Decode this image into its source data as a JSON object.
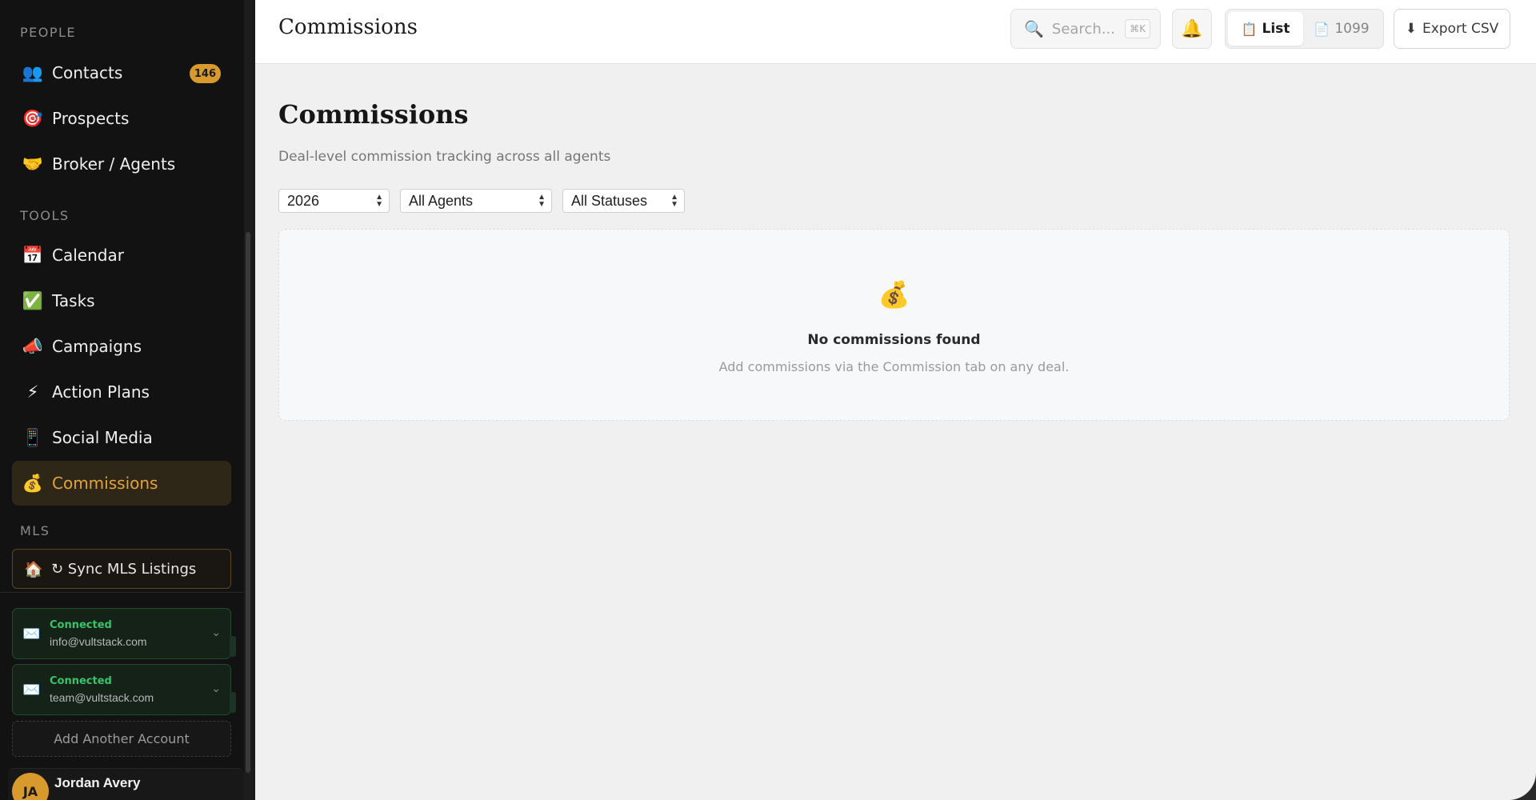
{
  "sidebar": {
    "sections": {
      "people": "PEOPLE",
      "tools": "TOOLS",
      "mls": "MLS"
    },
    "items": [
      {
        "id": "contacts",
        "icon": "👥",
        "label": "Contacts",
        "badge": "146"
      },
      {
        "id": "prospects",
        "icon": "🎯",
        "label": "Prospects"
      },
      {
        "id": "broker",
        "icon": "🤝",
        "label": "Broker / Agents"
      },
      {
        "id": "calendar",
        "icon": "📅",
        "label": "Calendar"
      },
      {
        "id": "tasks",
        "icon": "✅",
        "label": "Tasks"
      },
      {
        "id": "campaigns",
        "icon": "📣",
        "label": "Campaigns"
      },
      {
        "id": "action-plans",
        "icon": "⚡",
        "label": "Action Plans"
      },
      {
        "id": "social-media",
        "icon": "📱",
        "label": "Social Media"
      },
      {
        "id": "commissions",
        "icon": "💰",
        "label": "Commissions",
        "active": true
      }
    ],
    "mls_sync": {
      "icon": "🏠",
      "label": "↻ Sync MLS Listings"
    },
    "accounts": [
      {
        "icon": "✉️",
        "status": "Connected",
        "email": "info@vultstack.com"
      },
      {
        "icon": "✉️",
        "status": "Connected",
        "email": "team@vultstack.com"
      }
    ],
    "add_account": "Add Another Account",
    "user": {
      "initials": "JA",
      "name": "Jordan Avery"
    }
  },
  "header": {
    "title": "Commissions",
    "search": {
      "placeholder": "Search...",
      "shortcut": "⌘K"
    },
    "bell_icon": "🔔",
    "view_toggle": [
      {
        "icon": "📋",
        "label": "List",
        "active": true
      },
      {
        "icon": "📄",
        "label": "1099",
        "active": false
      }
    ],
    "export": {
      "icon": "⬇",
      "label": "Export CSV"
    }
  },
  "main": {
    "title": "Commissions",
    "subtitle": "Deal-level commission tracking across all agents",
    "filters": {
      "year": "2026",
      "agent": "All Agents",
      "status": "All Statuses"
    },
    "empty_state": {
      "icon": "💰",
      "title": "No commissions found",
      "message": "Add commissions via the Commission tab on any deal."
    }
  },
  "colors": {
    "accent": "#d89a2c",
    "sidebar_bg": "#121212",
    "connected": "#39c46a"
  }
}
